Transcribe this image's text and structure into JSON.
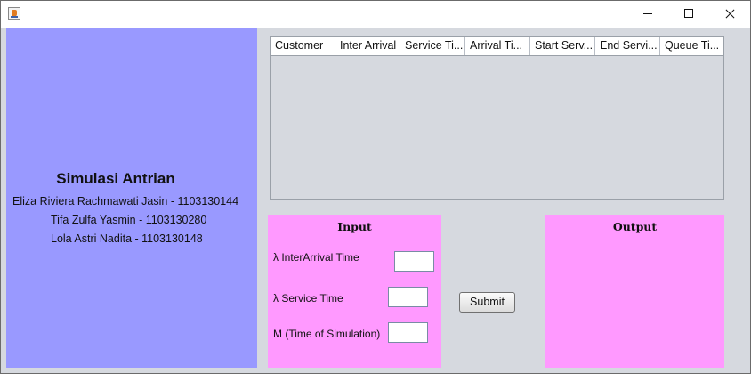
{
  "window": {
    "icon": "java-cup-icon",
    "controls": [
      "minimize",
      "maximize",
      "close"
    ]
  },
  "left_panel": {
    "title": "Simulasi Antrian",
    "members": [
      "Eliza Riviera Rachmawati Jasin - 1103130144",
      "Tifa Zulfa Yasmin - 1103130280",
      "Lola Astri Nadita - 1103130148"
    ],
    "background": "#9999ff"
  },
  "table": {
    "columns": [
      "Customer",
      "Inter Arrival",
      "Service Ti...",
      "Arrival Ti...",
      "Start Serv...",
      "End Servi...",
      "Queue Ti..."
    ],
    "rows": []
  },
  "input_panel": {
    "title": "Input",
    "background": "#ff99ff",
    "fields": [
      {
        "label": "λ InterArrival Time",
        "value": ""
      },
      {
        "label": "λ Service Time",
        "value": ""
      },
      {
        "label": "M (Time of Simulation)",
        "value": ""
      }
    ]
  },
  "submit_button": {
    "label": "Submit"
  },
  "output_panel": {
    "title": "Output",
    "background": "#ff99ff"
  }
}
